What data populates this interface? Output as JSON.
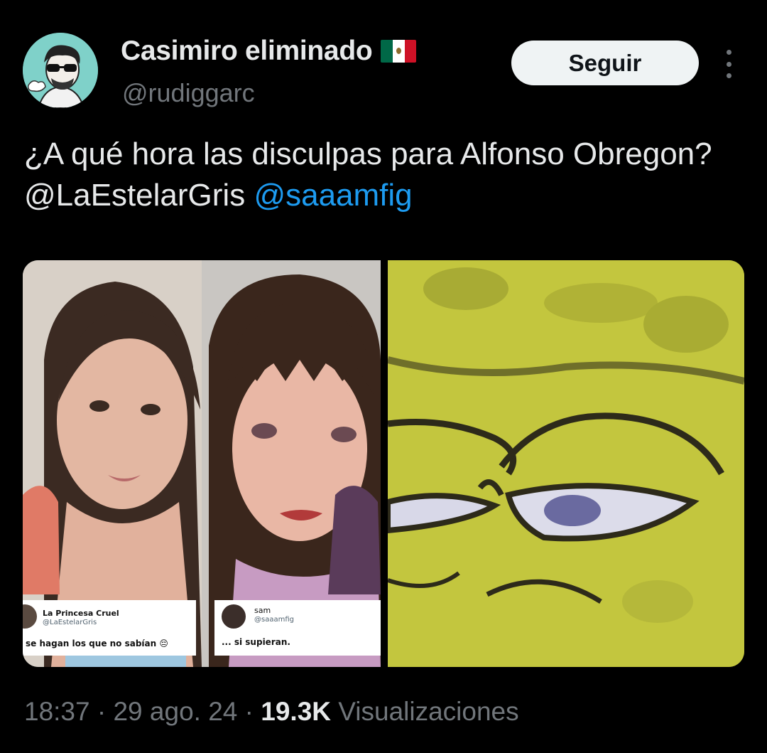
{
  "author": {
    "display_name": "Casimiro eliminado",
    "flag_icon": "mexico-flag-icon",
    "handle": "@rudiggarc",
    "avatar_icon": "cartoon-avatar-icon"
  },
  "follow_button": {
    "label": "Seguir"
  },
  "more_icon": "more-options-icon",
  "tweet": {
    "text_part1": "¿A qué hora las disculpas para Alfonso Obregon? ",
    "mention1": "@LaEstelarGris",
    "separator": " ",
    "mention2": "@saaamfig"
  },
  "media": {
    "left_image": {
      "card_a": {
        "name": "La Princesa Cruel",
        "handle": "@LaEstelarGris",
        "text": "se hagan los que no sabían 😔"
      },
      "card_b": {
        "name": "sam",
        "handle": "@saaamfig",
        "text": "... si supieran."
      }
    },
    "right_image": {
      "description_icon": "spongebob-meme-image"
    }
  },
  "footer": {
    "time": "18:37",
    "dot1": " · ",
    "date": "29 ago. 24",
    "dot2": " · ",
    "views_count": "19.3K",
    "views_label": " Visualizaciones"
  },
  "colors": {
    "background": "#000000",
    "text": "#e7e9ea",
    "muted": "#71767b",
    "link": "#1d9bf0",
    "button_bg": "#eff3f4"
  }
}
